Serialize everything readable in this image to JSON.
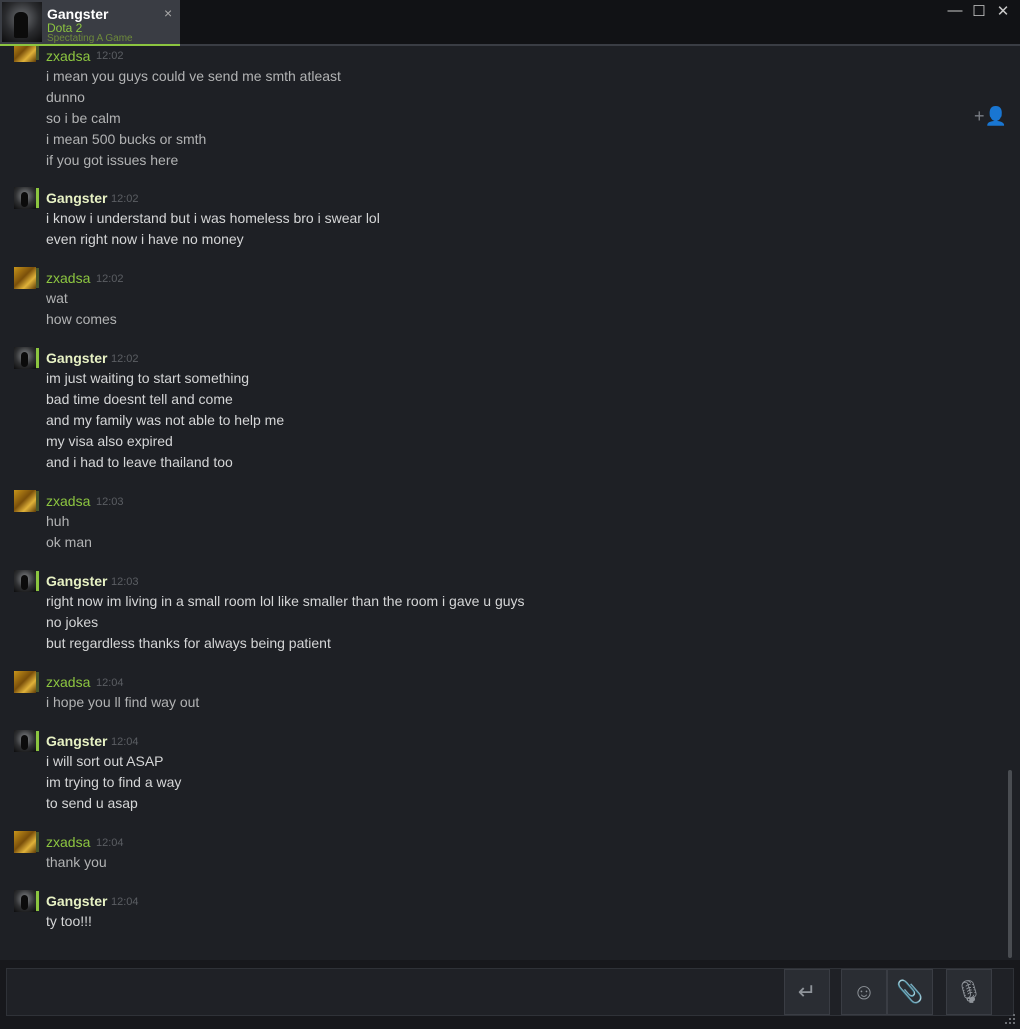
{
  "window": {
    "tab": {
      "name": "Gangster",
      "game": "Dota 2",
      "status": "Spectating A Game",
      "close_icon": "×"
    },
    "controls": {
      "minimize": "—",
      "maximize": "☐",
      "close": "✕"
    }
  },
  "chat": {
    "invite_icon": "+👤",
    "messages": [
      {
        "sender": "zxadsa",
        "time": "12:02",
        "lines": [
          "i mean you guys could ve send me smth atleast",
          "dunno",
          "so i be calm",
          "i mean 500 bucks or smth",
          "if you got issues here"
        ]
      },
      {
        "sender": "Gangster",
        "time": "12:02",
        "lines": [
          "i know i understand but i was homeless bro i swear lol",
          "even right now i have no money"
        ]
      },
      {
        "sender": "zxadsa",
        "time": "12:02",
        "lines": [
          "wat",
          "how comes"
        ]
      },
      {
        "sender": "Gangster",
        "time": "12:02",
        "lines": [
          "im just waiting to start something",
          "bad time doesnt tell and come",
          "and my family was not able to help me",
          "my visa also expired",
          "and i had to leave thailand too"
        ]
      },
      {
        "sender": "zxadsa",
        "time": "12:03",
        "lines": [
          "huh",
          "ok man"
        ]
      },
      {
        "sender": "Gangster",
        "time": "12:03",
        "lines": [
          "right now im living in a small room lol like smaller than the room i gave u guys",
          "no jokes",
          "but regardless thanks for always being patient"
        ]
      },
      {
        "sender": "zxadsa",
        "time": "12:04",
        "lines": [
          "i hope you ll find way out"
        ]
      },
      {
        "sender": "Gangster",
        "time": "12:04",
        "lines": [
          "i will sort out ASAP",
          "im trying to find a way",
          "to send u asap"
        ]
      },
      {
        "sender": "zxadsa",
        "time": "12:04",
        "lines": [
          "thank you"
        ]
      },
      {
        "sender": "Gangster",
        "time": "12:04",
        "lines": [
          "ty too!!!"
        ]
      }
    ]
  },
  "input": {
    "value": "",
    "send_icon": "↵",
    "emoji_icon": "☺",
    "attach_icon": "📎",
    "voice_icon": "🎙"
  },
  "colors": {
    "accent_green": "#8cc540",
    "background": "#1e2025"
  }
}
